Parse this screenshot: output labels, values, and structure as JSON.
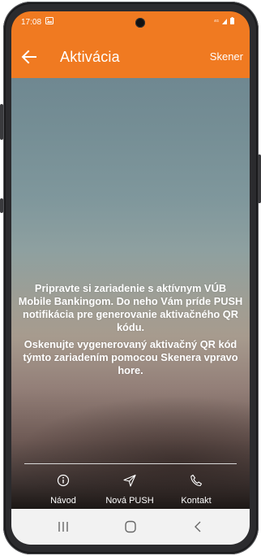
{
  "status_bar": {
    "time": "17:08",
    "notification_icon": "gallery-icon",
    "right_icons": [
      "network-type-icon",
      "signal-icon",
      "battery-icon"
    ]
  },
  "header": {
    "title": "Aktivácia",
    "back_icon": "back-arrow-icon",
    "action_label": "Skener"
  },
  "message": {
    "paragraph1": "Pripravte si zariadenie s aktívnym VÚB Mobile Bankingom. Do neho Vám príde PUSH notifikácia pre generovanie aktivačného QR kódu.",
    "paragraph2": "Oskenujte vygenerovaný aktivačný QR kód týmto zariadením pomocou Skenera vpravo hore."
  },
  "toolbar": {
    "items": [
      {
        "label": "Návod",
        "icon": "info-icon"
      },
      {
        "label": "Nová PUSH",
        "icon": "send-icon"
      },
      {
        "label": "Kontakt",
        "icon": "phone-icon"
      }
    ]
  },
  "system_nav": {
    "items": [
      "recent-apps-icon",
      "home-icon",
      "back-chevron-icon"
    ]
  },
  "colors": {
    "accent": "#f07a21",
    "nav_bar": "#f2f2f2",
    "text_on_accent": "#ffffff"
  }
}
